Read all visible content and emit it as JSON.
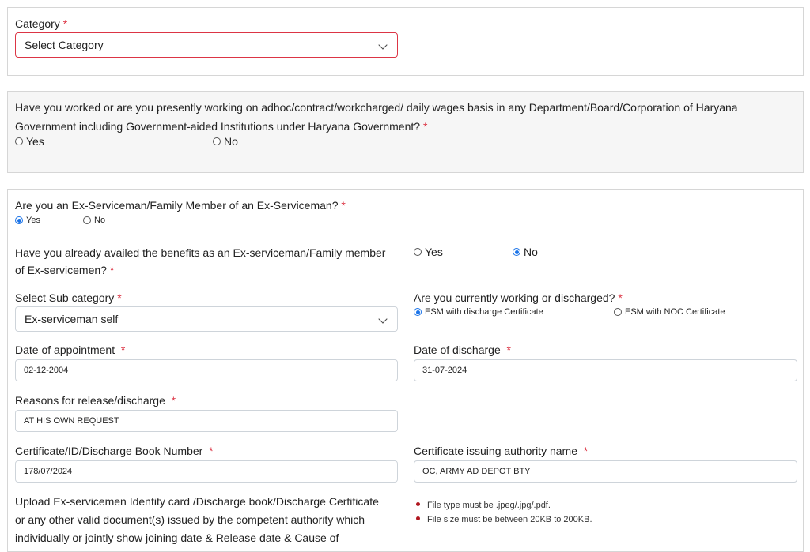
{
  "category": {
    "label": "Category",
    "required": "*",
    "selected": "Select Category"
  },
  "adhoc_question": {
    "line1": "Have you worked or are you presently working on adhoc/contract/workcharged/ daily wages basis in any Department/Board/Corporation of Haryana",
    "line2": "Government including Government-aided Institutions under Haryana Government?",
    "required": "*",
    "options": [
      "Yes",
      "No"
    ],
    "selected": null
  },
  "esm": {
    "question": "Are you an Ex-Serviceman/Family Member of an Ex-Serviceman?",
    "required": "*",
    "options": [
      "Yes",
      "No"
    ],
    "selected": "Yes",
    "benefits": {
      "line1": "Have you already availed the benefits as an Ex-serviceman/Family member",
      "line2": "of Ex-servicemen?",
      "required": "*",
      "options": [
        "Yes",
        "No"
      ],
      "selected": "No"
    },
    "sub_category": {
      "label": "Select Sub category",
      "required": "*",
      "selected": "Ex-serviceman self"
    },
    "working_status": {
      "label": "Are you currently working or discharged?",
      "required": "*",
      "options": [
        "ESM with discharge Certificate",
        "ESM with NOC Certificate"
      ],
      "selected": "ESM with discharge Certificate"
    },
    "date_of_appointment": {
      "label": "Date of appointment",
      "required": "*",
      "value": "02-12-2004"
    },
    "date_of_discharge": {
      "label": "Date of discharge",
      "required": "*",
      "value": "31-07-2024"
    },
    "release_reason": {
      "label": "Reasons for release/discharge",
      "required": "*",
      "value": "AT HIS OWN REQUEST"
    },
    "certificate_number": {
      "label": "Certificate/ID/Discharge Book Number",
      "required": "*",
      "value": "178/07/2024"
    },
    "issuing_authority": {
      "label": "Certificate issuing authority name",
      "required": "*",
      "value": "OC, ARMY AD DEPOT BTY"
    },
    "upload": {
      "line1": "Upload Ex-servicemen Identity card /Discharge book/Discharge Certificate",
      "line2": "or any other valid document(s) issued by the competent authority which",
      "line3": "individually or jointly show joining date & Release date & Cause of",
      "notes": [
        "File type must be .jpeg/.jpg/.pdf.",
        "File size must be between 20KB to 200KB."
      ]
    }
  },
  "colors": {
    "required": "#dc3545",
    "radio_checked": "#1a73e8",
    "invalid_border": "#dc3545",
    "bullet": "#b0151e"
  }
}
